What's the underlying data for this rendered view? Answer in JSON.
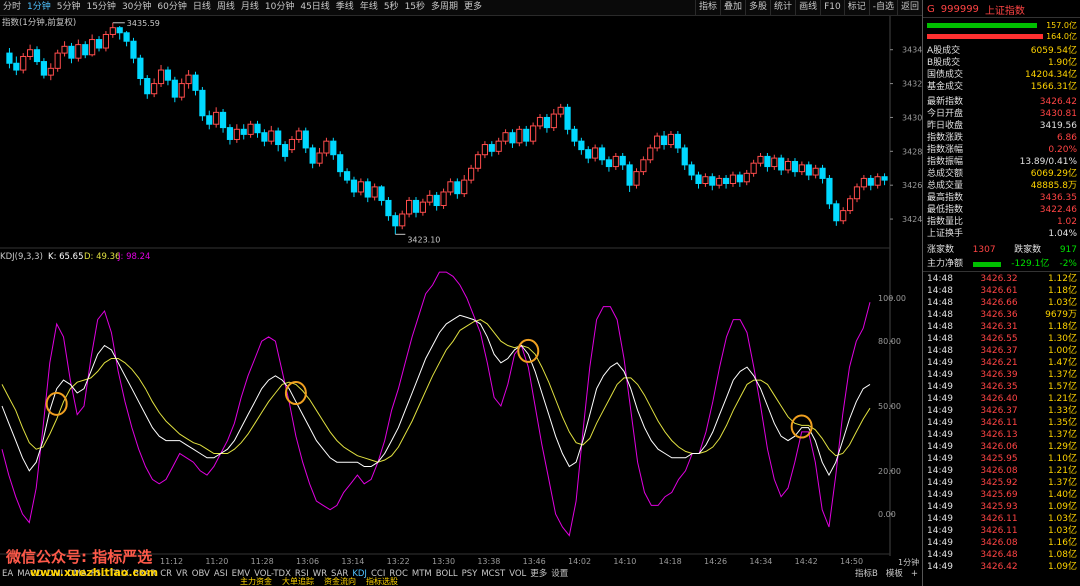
{
  "toolbar": {
    "periods": [
      "分时",
      "1分钟",
      "5分钟",
      "15分钟",
      "30分钟",
      "60分钟",
      "日线",
      "周线",
      "月线",
      "10分钟",
      "45日线",
      "季线",
      "年线",
      "5秒",
      "15秒",
      "多周期",
      "更多"
    ],
    "active_period": 1,
    "tools": [
      "指标",
      "叠加",
      "多股",
      "统计",
      "画线",
      "F10",
      "标记",
      "-自选",
      "返回"
    ]
  },
  "main_chart": {
    "title": "指数(1分钟,前复权)",
    "high_label": "3435.59",
    "low_label": "3423.10",
    "axis": {
      "min": 3423,
      "max": 3435.4,
      "ticks": [
        3424,
        3426,
        3428,
        3430,
        3432,
        3434
      ]
    },
    "candles": [
      [
        3433.8,
        3433.2,
        3434.1,
        3432.9
      ],
      [
        3433.2,
        3432.8,
        3433.6,
        3432.5
      ],
      [
        3432.8,
        3433.6,
        3433.8,
        3432.6
      ],
      [
        3433.6,
        3434.0,
        3434.3,
        3433.4
      ],
      [
        3434.0,
        3433.3,
        3434.2,
        3433.1
      ],
      [
        3433.3,
        3432.5,
        3433.5,
        3432.3
      ],
      [
        3432.5,
        3432.9,
        3433.2,
        3432.2
      ],
      [
        3432.9,
        3433.8,
        3434.0,
        3432.7
      ],
      [
        3433.8,
        3434.2,
        3434.5,
        3433.6
      ],
      [
        3434.2,
        3433.5,
        3434.4,
        3433.2
      ],
      [
        3433.5,
        3434.3,
        3434.6,
        3433.3
      ],
      [
        3434.3,
        3433.7,
        3434.5,
        3433.5
      ],
      [
        3433.7,
        3434.6,
        3434.9,
        3433.6
      ],
      [
        3434.6,
        3434.1,
        3434.8,
        3433.9
      ],
      [
        3434.1,
        3434.9,
        3435.1,
        3433.9
      ],
      [
        3434.9,
        3435.3,
        3435.59,
        3434.7
      ],
      [
        3435.3,
        3435.0,
        3435.4,
        3434.6
      ],
      [
        3435.0,
        3434.5,
        3435.1,
        3434.2
      ],
      [
        3434.5,
        3433.5,
        3434.7,
        3433.2
      ],
      [
        3433.5,
        3432.3,
        3433.7,
        3431.9
      ],
      [
        3432.3,
        3431.4,
        3432.5,
        3431.1
      ],
      [
        3431.4,
        3432.0,
        3432.3,
        3431.2
      ],
      [
        3432.0,
        3432.8,
        3433.1,
        3431.8
      ],
      [
        3432.8,
        3432.2,
        3433.0,
        3431.9
      ],
      [
        3432.2,
        3431.2,
        3432.4,
        3430.9
      ],
      [
        3431.2,
        3432.0,
        3432.3,
        3431.0
      ],
      [
        3432.0,
        3432.5,
        3432.8,
        3431.7
      ],
      [
        3432.5,
        3431.6,
        3432.7,
        3431.3
      ],
      [
        3431.6,
        3430.1,
        3431.8,
        3429.8
      ],
      [
        3430.1,
        3429.6,
        3430.4,
        3429.3
      ],
      [
        3429.6,
        3430.3,
        3430.6,
        3429.4
      ],
      [
        3430.3,
        3429.4,
        3430.5,
        3429.1
      ],
      [
        3429.4,
        3428.7,
        3429.6,
        3428.4
      ],
      [
        3428.7,
        3429.3,
        3429.6,
        3428.5
      ],
      [
        3429.3,
        3429.0,
        3429.6,
        3428.7
      ],
      [
        3429.0,
        3429.6,
        3429.8,
        3428.8
      ],
      [
        3429.6,
        3429.1,
        3429.8,
        3428.8
      ],
      [
        3429.1,
        3428.6,
        3429.3,
        3428.3
      ],
      [
        3428.6,
        3429.2,
        3429.5,
        3428.4
      ],
      [
        3429.2,
        3428.4,
        3429.4,
        3428.0
      ],
      [
        3428.4,
        3427.7,
        3428.6,
        3427.4
      ],
      [
        3428.1,
        3428.7,
        3428.9,
        3427.9
      ],
      [
        3428.7,
        3429.2,
        3429.4,
        3428.5
      ],
      [
        3429.2,
        3428.2,
        3429.4,
        3427.9
      ],
      [
        3428.2,
        3427.3,
        3428.4,
        3427.0
      ],
      [
        3427.3,
        3427.9,
        3428.2,
        3427.1
      ],
      [
        3427.9,
        3428.6,
        3428.8,
        3427.7
      ],
      [
        3428.6,
        3427.8,
        3428.8,
        3427.5
      ],
      [
        3427.8,
        3426.8,
        3428.0,
        3426.5
      ],
      [
        3426.8,
        3426.3,
        3427.0,
        3426.1
      ],
      [
        3426.3,
        3425.6,
        3426.5,
        3425.3
      ],
      [
        3425.6,
        3426.2,
        3426.4,
        3425.4
      ],
      [
        3426.2,
        3425.3,
        3426.4,
        3425.0
      ],
      [
        3425.3,
        3425.9,
        3426.1,
        3425.1
      ],
      [
        3425.9,
        3425.1,
        3426.0,
        3424.8
      ],
      [
        3425.1,
        3424.2,
        3425.3,
        3423.9
      ],
      [
        3424.2,
        3423.6,
        3424.4,
        3423.1
      ],
      [
        3423.6,
        3424.3,
        3424.5,
        3423.4
      ],
      [
        3424.3,
        3425.1,
        3425.3,
        3424.1
      ],
      [
        3425.1,
        3424.4,
        3425.3,
        3424.1
      ],
      [
        3424.4,
        3425.0,
        3425.2,
        3424.2
      ],
      [
        3425.0,
        3425.4,
        3425.7,
        3424.8
      ],
      [
        3425.4,
        3424.8,
        3425.6,
        3424.5
      ],
      [
        3424.8,
        3425.6,
        3425.8,
        3424.6
      ],
      [
        3425.6,
        3426.2,
        3426.4,
        3425.4
      ],
      [
        3426.2,
        3425.5,
        3426.4,
        3425.2
      ],
      [
        3425.5,
        3426.3,
        3426.6,
        3425.3
      ],
      [
        3426.3,
        3427.0,
        3427.2,
        3426.1
      ],
      [
        3427.0,
        3427.8,
        3428.0,
        3426.8
      ],
      [
        3427.8,
        3428.4,
        3428.6,
        3427.6
      ],
      [
        3428.4,
        3428.0,
        3428.6,
        3427.7
      ],
      [
        3428.0,
        3428.6,
        3428.8,
        3427.8
      ],
      [
        3428.6,
        3429.1,
        3429.3,
        3428.4
      ],
      [
        3429.1,
        3428.5,
        3429.3,
        3428.2
      ],
      [
        3428.5,
        3429.3,
        3429.5,
        3428.3
      ],
      [
        3429.3,
        3428.6,
        3429.5,
        3428.3
      ],
      [
        3428.6,
        3429.5,
        3429.7,
        3428.4
      ],
      [
        3429.5,
        3430.0,
        3430.2,
        3429.3
      ],
      [
        3430.0,
        3429.4,
        3430.2,
        3429.1
      ],
      [
        3429.4,
        3430.2,
        3430.5,
        3429.2
      ],
      [
        3430.2,
        3430.6,
        3430.8,
        3430.0
      ],
      [
        3430.6,
        3429.3,
        3430.8,
        3429.0
      ],
      [
        3429.3,
        3428.6,
        3429.5,
        3428.3
      ],
      [
        3428.6,
        3428.1,
        3428.8,
        3427.8
      ],
      [
        3428.1,
        3427.6,
        3428.3,
        3427.3
      ],
      [
        3427.6,
        3428.2,
        3428.4,
        3427.4
      ],
      [
        3428.2,
        3427.5,
        3428.4,
        3427.2
      ],
      [
        3427.5,
        3427.1,
        3427.7,
        3426.8
      ],
      [
        3427.1,
        3427.7,
        3427.9,
        3426.9
      ],
      [
        3427.7,
        3427.2,
        3427.9,
        3426.9
      ],
      [
        3427.2,
        3426.0,
        3427.4,
        3425.6
      ],
      [
        3426.0,
        3426.8,
        3427.0,
        3425.8
      ],
      [
        3426.8,
        3427.5,
        3427.7,
        3426.6
      ],
      [
        3427.5,
        3428.2,
        3428.4,
        3427.3
      ],
      [
        3428.2,
        3428.9,
        3429.1,
        3428.0
      ],
      [
        3428.9,
        3428.4,
        3429.2,
        3428.1
      ],
      [
        3428.4,
        3429.0,
        3429.2,
        3428.2
      ],
      [
        3429.0,
        3428.2,
        3429.2,
        3427.9
      ],
      [
        3428.2,
        3427.2,
        3428.4,
        3426.9
      ],
      [
        3427.2,
        3426.6,
        3427.4,
        3426.3
      ],
      [
        3426.6,
        3426.1,
        3426.8,
        3425.8
      ],
      [
        3426.1,
        3426.5,
        3426.7,
        3425.9
      ],
      [
        3426.5,
        3426.0,
        3426.7,
        3425.7
      ],
      [
        3426.0,
        3426.4,
        3426.6,
        3425.8
      ],
      [
        3426.4,
        3426.1,
        3426.6,
        3425.8
      ],
      [
        3426.1,
        3426.6,
        3426.8,
        3425.9
      ],
      [
        3426.6,
        3426.2,
        3426.8,
        3425.9
      ],
      [
        3426.2,
        3426.7,
        3426.9,
        3426.0
      ],
      [
        3426.7,
        3427.3,
        3427.5,
        3426.5
      ],
      [
        3427.3,
        3427.7,
        3427.9,
        3427.1
      ],
      [
        3427.7,
        3427.1,
        3427.9,
        3426.8
      ],
      [
        3427.1,
        3427.6,
        3427.8,
        3426.9
      ],
      [
        3427.6,
        3426.9,
        3427.8,
        3426.6
      ],
      [
        3426.9,
        3427.4,
        3427.6,
        3426.7
      ],
      [
        3427.4,
        3426.8,
        3427.6,
        3426.5
      ],
      [
        3426.8,
        3427.2,
        3427.4,
        3426.6
      ],
      [
        3427.2,
        3426.6,
        3427.4,
        3426.3
      ],
      [
        3426.6,
        3427.0,
        3427.2,
        3426.4
      ],
      [
        3427.0,
        3426.4,
        3427.2,
        3426.1
      ],
      [
        3426.4,
        3424.9,
        3426.6,
        3424.6
      ],
      [
        3424.9,
        3423.9,
        3425.1,
        3423.6
      ],
      [
        3423.9,
        3424.5,
        3424.7,
        3423.7
      ],
      [
        3424.5,
        3425.2,
        3425.4,
        3424.3
      ],
      [
        3425.2,
        3425.9,
        3426.1,
        3425.0
      ],
      [
        3425.9,
        3426.4,
        3426.6,
        3425.7
      ],
      [
        3426.4,
        3426.0,
        3426.6,
        3425.7
      ],
      [
        3426.0,
        3426.5,
        3426.7,
        3425.8
      ],
      [
        3426.5,
        3426.3,
        3426.7,
        3426.0
      ]
    ]
  },
  "kdj": {
    "title": "KDJ(9,3,3)",
    "k_label": "K: 65.65",
    "d_label": "D: 49.36",
    "j_label": "J: 98.24",
    "axis_ticks": [
      "100.00",
      "80.00",
      "50.00",
      "20.00",
      "0.00"
    ],
    "k": [
      50,
      42,
      34,
      26,
      20,
      24,
      34,
      48,
      58,
      62,
      60,
      56,
      58,
      66,
      74,
      78,
      76,
      70,
      64,
      58,
      52,
      46,
      40,
      36,
      34,
      34,
      34,
      32,
      30,
      28,
      26,
      26,
      28,
      30,
      34,
      40,
      46,
      52,
      58,
      62,
      64,
      62,
      58,
      52,
      46,
      40,
      34,
      30,
      26,
      24,
      24,
      24,
      24,
      22,
      22,
      24,
      28,
      34,
      40,
      48,
      56,
      64,
      72,
      78,
      84,
      88,
      90,
      92,
      91,
      90,
      88,
      82,
      74,
      70,
      72,
      76,
      78,
      74,
      66,
      56,
      46,
      36,
      28,
      22,
      24,
      34,
      46,
      58,
      64,
      68,
      70,
      66,
      58,
      48,
      40,
      34,
      30,
      28,
      26,
      26,
      26,
      28,
      28,
      32,
      38,
      46,
      54,
      62,
      66,
      68,
      64,
      58,
      50,
      42,
      36,
      34,
      36,
      40,
      40,
      34,
      24,
      18,
      24,
      34,
      44,
      52,
      58,
      60
    ],
    "d": [
      60,
      54,
      48,
      40,
      33,
      30,
      31,
      37,
      44,
      52,
      58,
      61,
      62,
      63,
      66,
      70,
      72,
      72,
      70,
      67,
      63,
      58,
      52,
      47,
      43,
      40,
      37,
      35,
      33,
      32,
      30,
      28,
      28,
      28,
      30,
      33,
      37,
      42,
      47,
      52,
      56,
      60,
      61,
      60,
      57,
      53,
      48,
      43,
      38,
      34,
      31,
      29,
      27,
      26,
      25,
      24,
      25,
      27,
      31,
      37,
      43,
      50,
      57,
      64,
      70,
      76,
      80,
      85,
      87,
      89,
      90,
      88,
      84,
      80,
      78,
      77,
      78,
      77,
      74,
      68,
      61,
      53,
      45,
      38,
      33,
      32,
      35,
      42,
      48,
      54,
      60,
      63,
      63,
      60,
      55,
      49,
      43,
      38,
      34,
      31,
      29,
      28,
      28,
      29,
      31,
      35,
      41,
      48,
      54,
      60,
      62,
      62,
      60,
      55,
      50,
      45,
      42,
      41,
      41,
      39,
      35,
      30,
      27,
      28,
      32,
      38,
      44,
      49
    ],
    "j": [
      30,
      18,
      8,
      0,
      -4,
      12,
      40,
      70,
      88,
      82,
      62,
      46,
      50,
      72,
      90,
      94,
      84,
      66,
      52,
      40,
      30,
      22,
      16,
      14,
      16,
      22,
      28,
      26,
      24,
      20,
      18,
      22,
      28,
      34,
      42,
      54,
      64,
      72,
      80,
      82,
      80,
      66,
      52,
      36,
      24,
      14,
      6,
      4,
      2,
      4,
      10,
      14,
      18,
      14,
      16,
      24,
      34,
      48,
      58,
      70,
      82,
      92,
      102,
      106,
      112,
      112,
      110,
      106,
      100,
      92,
      84,
      70,
      54,
      50,
      60,
      74,
      78,
      68,
      50,
      32,
      16,
      0,
      -6,
      -10,
      6,
      38,
      68,
      90,
      96,
      96,
      90,
      72,
      48,
      24,
      10,
      4,
      4,
      8,
      10,
      16,
      20,
      28,
      28,
      38,
      52,
      68,
      82,
      90,
      90,
      84,
      68,
      50,
      30,
      16,
      8,
      12,
      24,
      38,
      38,
      24,
      2,
      -6,
      18,
      46,
      68,
      80,
      86,
      98
    ],
    "circles": [
      8,
      43,
      77,
      117,
      142,
      165
    ],
    "time_labels": [
      "11:12",
      "11:20",
      "11:28",
      "13:06",
      "13:14",
      "13:22",
      "13:30",
      "13:38",
      "13:46",
      "14:02",
      "14:10",
      "14:18",
      "14:26",
      "14:34",
      "14:42",
      "14:50"
    ]
  },
  "bottom": {
    "tabs": [
      "EA",
      "MACD",
      "DMI",
      "DMA",
      "FSL",
      "TRIX",
      "BRAR",
      "CR",
      "VR",
      "OBV",
      "ASI",
      "EMV",
      "VOL-TDX",
      "RSI",
      "WR",
      "SAR",
      "KDJ",
      "CCI",
      "ROC",
      "MTM",
      "BOLL",
      "PSY",
      "MCST",
      "VOL",
      "更多",
      "设置"
    ],
    "active_tab": "KDJ",
    "right_tabs": [
      "指标B",
      "模板",
      "+"
    ],
    "period_label": "1分钟",
    "watermark": "微信公众号: 指标严选",
    "watermark_url": "www.xuezhitiao.com",
    "sub_tabs": [
      "主力资金",
      "大单追踪",
      "资金流向",
      "指标选股"
    ]
  },
  "quote": {
    "flag": "G",
    "code": "999999",
    "name": "上证指数",
    "bar1_value": "157.0亿",
    "bar2_value": "164.0亿",
    "stats": [
      {
        "label": "A股成交",
        "value": "6059.54亿",
        "color": "yel"
      },
      {
        "label": "B股成交",
        "value": "1.90亿",
        "color": "yel"
      },
      {
        "label": "国债成交",
        "value": "14204.34亿",
        "color": "yel"
      },
      {
        "label": "基金成交",
        "value": "1566.31亿",
        "color": "yel"
      }
    ],
    "details": [
      {
        "label": "最新指数",
        "value": "3426.42",
        "color": "red"
      },
      {
        "label": "今日开盘",
        "value": "3430.81",
        "color": "red"
      },
      {
        "label": "昨日收盘",
        "value": "3419.56",
        "color": "wht"
      },
      {
        "label": "指数涨跌",
        "value": "6.86",
        "color": "red"
      },
      {
        "label": "指数涨幅",
        "value": "0.20%",
        "color": "red"
      },
      {
        "label": "指数振幅",
        "value": "13.89/0.41%",
        "color": "wht"
      },
      {
        "label": "总成交额",
        "value": "6069.29亿",
        "color": "yel"
      },
      {
        "label": "总成交量",
        "value": "48885.8万",
        "color": "yel"
      },
      {
        "label": "最高指数",
        "value": "3436.35",
        "color": "red"
      },
      {
        "label": "最低指数",
        "value": "3422.46",
        "color": "red"
      },
      {
        "label": "指数量比",
        "value": "1.02",
        "color": "red"
      },
      {
        "label": "上证换手",
        "value": "1.04%",
        "color": "wht"
      }
    ],
    "up_label": "涨家数",
    "up_value": "1307",
    "down_label": "跌家数",
    "down_value": "917",
    "flow_label": "主力净额",
    "flow_value": "-129.1亿",
    "flow_pct": "-2%",
    "ticks": [
      [
        "14:48",
        "3426.32",
        "1.12亿"
      ],
      [
        "14:48",
        "3426.61",
        "1.18亿"
      ],
      [
        "14:48",
        "3426.66",
        "1.03亿"
      ],
      [
        "14:48",
        "3426.36",
        "9679万"
      ],
      [
        "14:48",
        "3426.31",
        "1.18亿"
      ],
      [
        "14:48",
        "3426.55",
        "1.30亿"
      ],
      [
        "14:48",
        "3426.37",
        "1.00亿"
      ],
      [
        "14:49",
        "3426.21",
        "1.47亿"
      ],
      [
        "14:49",
        "3426.39",
        "1.37亿"
      ],
      [
        "14:49",
        "3426.35",
        "1.57亿"
      ],
      [
        "14:49",
        "3426.40",
        "1.21亿"
      ],
      [
        "14:49",
        "3426.37",
        "1.33亿"
      ],
      [
        "14:49",
        "3426.11",
        "1.35亿"
      ],
      [
        "14:49",
        "3426.13",
        "1.37亿"
      ],
      [
        "14:49",
        "3426.06",
        "1.29亿"
      ],
      [
        "14:49",
        "3425.95",
        "1.10亿"
      ],
      [
        "14:49",
        "3426.08",
        "1.21亿"
      ],
      [
        "14:49",
        "3425.92",
        "1.37亿"
      ],
      [
        "14:49",
        "3425.69",
        "1.40亿"
      ],
      [
        "14:49",
        "3425.93",
        "1.09亿"
      ],
      [
        "14:49",
        "3426.11",
        "1.03亿"
      ],
      [
        "14:49",
        "3426.11",
        "1.03亿"
      ],
      [
        "14:49",
        "3426.08",
        "1.16亿"
      ],
      [
        "14:49",
        "3426.48",
        "1.08亿"
      ],
      [
        "14:49",
        "3426.42",
        "1.09亿"
      ]
    ]
  },
  "colors": {
    "up": "#ff4d4d",
    "down": "#00d8ff",
    "k": "#ffffff",
    "d": "#e0e040",
    "j": "#e000e0",
    "circle": "#f0a020",
    "accent": "#4fc3ff"
  }
}
